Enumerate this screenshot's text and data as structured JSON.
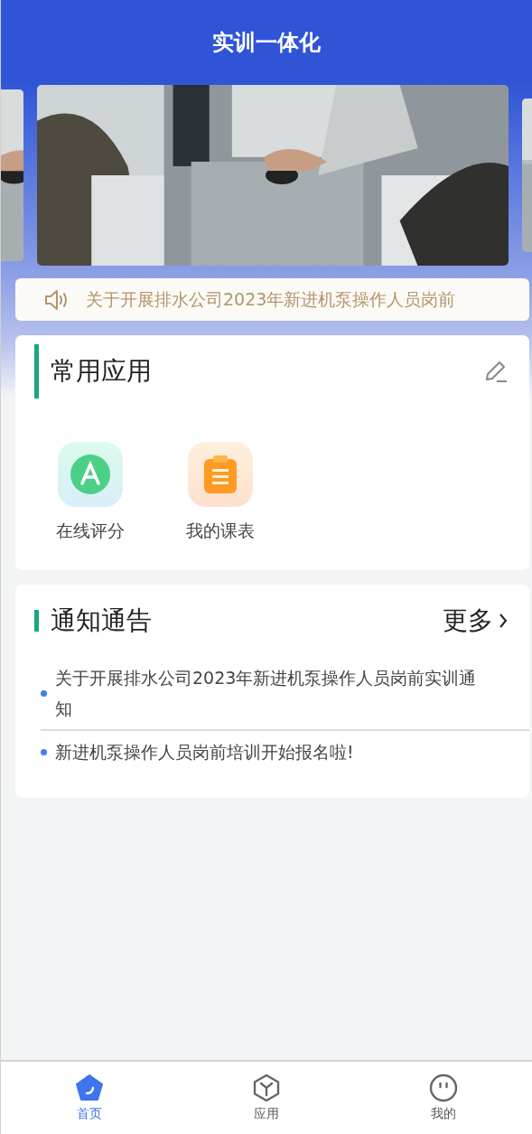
{
  "header": {
    "title": "实训一体化"
  },
  "notice_bar": {
    "text": "关于开展排水公司2023年新进机泵操作人员岗前"
  },
  "apps_section": {
    "title": "常用应用",
    "apps": [
      {
        "label": "在线评分",
        "kind": "score"
      },
      {
        "label": "我的课表",
        "kind": "schedule"
      }
    ]
  },
  "notices_section": {
    "title": "通知通告",
    "more": "更多",
    "items": [
      {
        "text": "关于开展排水公司2023年新进机泵操作人员岗前实训通知"
      },
      {
        "text": "新进机泵操作人员岗前培训开始报名啦!"
      }
    ]
  },
  "tab_bar": [
    {
      "label": "首页",
      "kind": "home",
      "selected": true
    },
    {
      "label": "应用",
      "kind": "apps",
      "selected": false
    },
    {
      "label": "我的",
      "kind": "me",
      "selected": false
    }
  ]
}
